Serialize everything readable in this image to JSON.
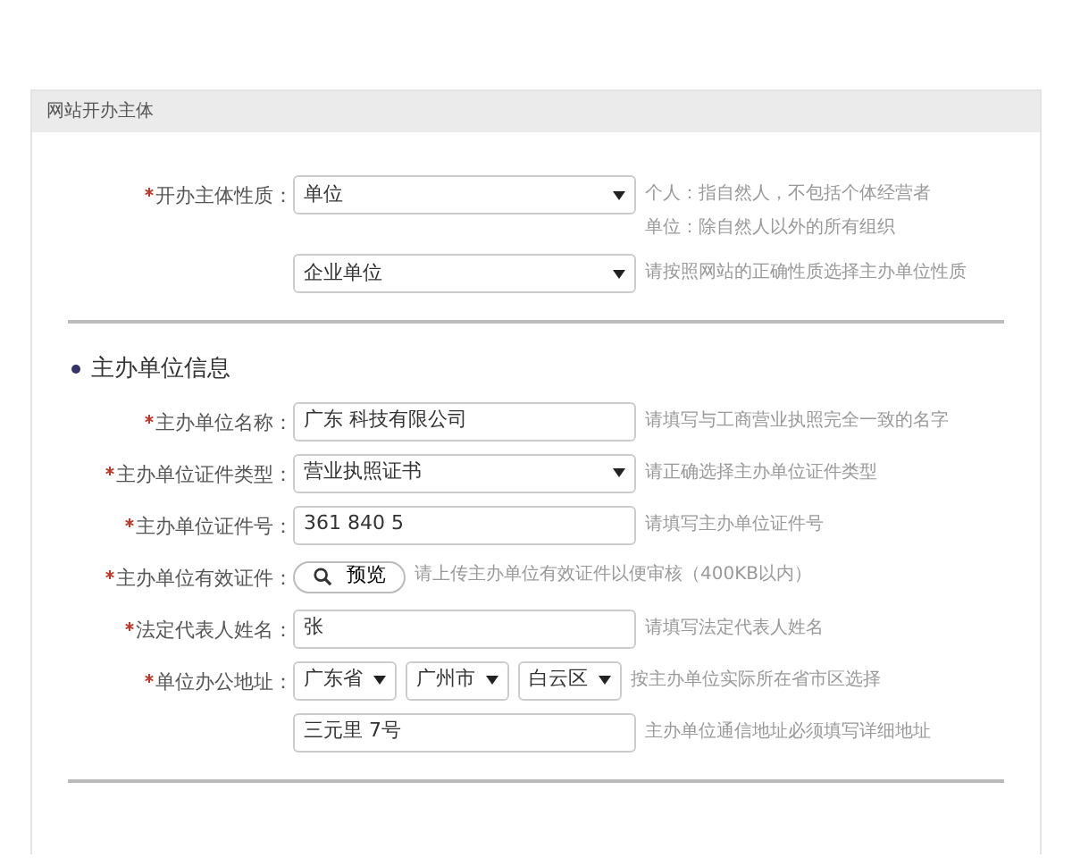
{
  "panel": {
    "title": "网站开办主体"
  },
  "subject_rows": [
    {
      "kind": "select",
      "label": "开办主体性质：",
      "required": true,
      "value": "单位",
      "hints": [
        "个人：指自然人，不包括个体经营者",
        "单位：除自然人以外的所有组织"
      ]
    },
    {
      "kind": "select",
      "value": "企业单位",
      "hints": [
        "请按照网站的正确性质选择主办单位性质"
      ]
    }
  ],
  "section": {
    "title": "主办单位信息"
  },
  "rows": [
    {
      "kind": "text",
      "label": "主办单位名称：",
      "required": true,
      "value": "广东 科技有限公司",
      "hints": [
        "请填写与工商营业执照完全一致的名字"
      ]
    },
    {
      "kind": "select",
      "label": "主办单位证件类型：",
      "required": true,
      "value": "营业执照证书",
      "hints": [
        "请正确选择主办单位证件类型"
      ]
    },
    {
      "kind": "text",
      "label": "主办单位证件号：",
      "required": true,
      "value": "361 840 5",
      "hints": [
        "请填写主办单位证件号"
      ]
    },
    {
      "kind": "upload",
      "label": "主办单位有效证件：",
      "required": true,
      "value": "预览",
      "hints": [
        "请上传主办单位有效证件以便审核（400KB以内）"
      ]
    },
    {
      "kind": "text",
      "label": "法定代表人姓名：",
      "required": true,
      "value": "张",
      "hints": [
        "请填写法定代表人姓名"
      ]
    },
    {
      "kind": "address",
      "label": "单位办公地址：",
      "required": true,
      "values": [
        "广东省",
        "广州市",
        "白云区"
      ],
      "hints": [
        "按主办单位实际所在省市区选择"
      ]
    },
    {
      "kind": "text",
      "value": "三元里 7号",
      "hints": [
        "主办单位通信地址必须填写详细地址"
      ]
    }
  ]
}
